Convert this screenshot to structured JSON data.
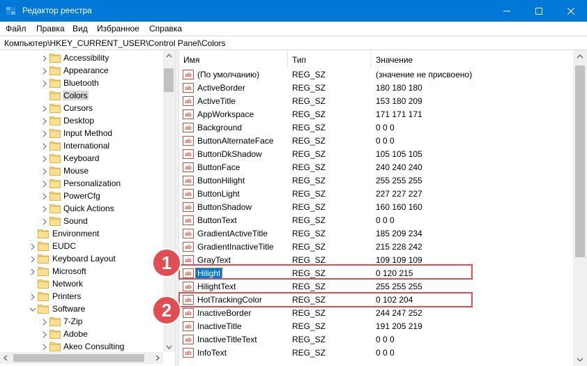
{
  "window": {
    "title": "Редактор реестра"
  },
  "menu": [
    "Файл",
    "Правка",
    "Вид",
    "Избранное",
    "Справка"
  ],
  "address": "Компьютер\\HKEY_CURRENT_USER\\Control Panel\\Colors",
  "tree": {
    "items": [
      {
        "label": "Accessibility",
        "expandable": true
      },
      {
        "label": "Appearance",
        "expandable": true
      },
      {
        "label": "Bluetooth",
        "expandable": true
      },
      {
        "label": "Colors",
        "expandable": false,
        "selected": true
      },
      {
        "label": "Cursors",
        "expandable": true
      },
      {
        "label": "Desktop",
        "expandable": true
      },
      {
        "label": "Input Method",
        "expandable": true
      },
      {
        "label": "International",
        "expandable": true
      },
      {
        "label": "Keyboard",
        "expandable": true
      },
      {
        "label": "Mouse",
        "expandable": true
      },
      {
        "label": "Personalization",
        "expandable": true
      },
      {
        "label": "PowerCfg",
        "expandable": true
      },
      {
        "label": "Quick Actions",
        "expandable": true
      },
      {
        "label": "Sound",
        "expandable": true
      },
      {
        "label": "Environment",
        "expandable": false
      },
      {
        "label": "EUDC",
        "expandable": true
      },
      {
        "label": "Keyboard Layout",
        "expandable": true
      },
      {
        "label": "Microsoft",
        "expandable": true
      },
      {
        "label": "Network",
        "expandable": false
      },
      {
        "label": "Printers",
        "expandable": true
      },
      {
        "label": "Software",
        "expandable": true,
        "expanded": true
      },
      {
        "label": "7-Zip",
        "expandable": true
      },
      {
        "label": "Adobe",
        "expandable": true
      },
      {
        "label": "Akeo Consulting",
        "expandable": true
      }
    ]
  },
  "list": {
    "headers": [
      "Имя",
      "Тип",
      "Значение"
    ],
    "rows": [
      {
        "name": "(По умолчанию)",
        "type": "REG_SZ",
        "value": "(значение не присвоено)"
      },
      {
        "name": "ActiveBorder",
        "type": "REG_SZ",
        "value": "180 180 180"
      },
      {
        "name": "ActiveTitle",
        "type": "REG_SZ",
        "value": "153 180 209"
      },
      {
        "name": "AppWorkspace",
        "type": "REG_SZ",
        "value": "171 171 171"
      },
      {
        "name": "Background",
        "type": "REG_SZ",
        "value": "0 0 0"
      },
      {
        "name": "ButtonAlternateFace",
        "type": "REG_SZ",
        "value": "0 0 0"
      },
      {
        "name": "ButtonDkShadow",
        "type": "REG_SZ",
        "value": "105 105 105"
      },
      {
        "name": "ButtonFace",
        "type": "REG_SZ",
        "value": "240 240 240"
      },
      {
        "name": "ButtonHilight",
        "type": "REG_SZ",
        "value": "255 255 255"
      },
      {
        "name": "ButtonLight",
        "type": "REG_SZ",
        "value": "227 227 227"
      },
      {
        "name": "ButtonShadow",
        "type": "REG_SZ",
        "value": "160 160 160"
      },
      {
        "name": "ButtonText",
        "type": "REG_SZ",
        "value": "0 0 0"
      },
      {
        "name": "GradientActiveTitle",
        "type": "REG_SZ",
        "value": "185 209 234"
      },
      {
        "name": "GradientInactiveTitle",
        "type": "REG_SZ",
        "value": "215 228 242"
      },
      {
        "name": "GrayText",
        "type": "REG_SZ",
        "value": "109 109 109"
      },
      {
        "name": "Hilight",
        "type": "REG_SZ",
        "value": "0 120 215",
        "selected": true
      },
      {
        "name": "HilightText",
        "type": "REG_SZ",
        "value": "255 255 255"
      },
      {
        "name": "HotTrackingColor",
        "type": "REG_SZ",
        "value": "0 102 204"
      },
      {
        "name": "InactiveBorder",
        "type": "REG_SZ",
        "value": "244 247 252"
      },
      {
        "name": "InactiveTitle",
        "type": "REG_SZ",
        "value": "191 205 219"
      },
      {
        "name": "InactiveTitleText",
        "type": "REG_SZ",
        "value": "0 0 0"
      },
      {
        "name": "InfoText",
        "type": "REG_SZ",
        "value": "0 0 0"
      }
    ]
  },
  "callouts": [
    "1",
    "2"
  ],
  "colors": {
    "titlebar": "#0078d7",
    "selection": "#0078d7",
    "callout": "#e04e54",
    "folder": "#f8d775"
  }
}
